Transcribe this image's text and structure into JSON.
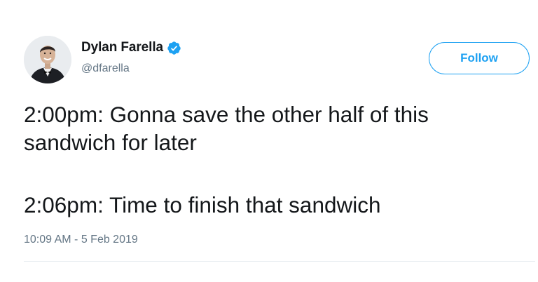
{
  "author": {
    "display_name": "Dylan Farella",
    "handle": "@dfarella",
    "verified": true
  },
  "follow_button": {
    "label": "Follow"
  },
  "tweet": {
    "lines": [
      "2:00pm: Gonna save the other half of this",
      "sandwich for later",
      "2:06pm: Time to finish that sandwich"
    ],
    "timestamp": "10:09 AM - 5 Feb 2019"
  },
  "colors": {
    "accent": "#1da1f2",
    "text": "#14171a",
    "secondary_text": "#657786"
  },
  "icons": {
    "verified": "verified-badge-icon",
    "avatar": "profile-photo"
  }
}
